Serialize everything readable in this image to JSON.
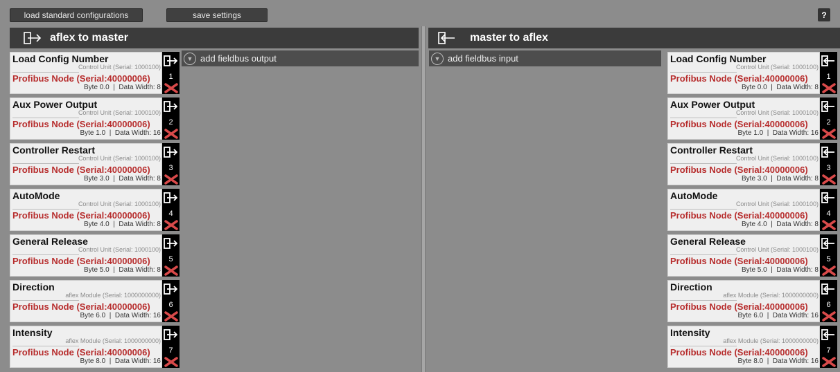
{
  "toolbar": {
    "load_label": "load standard configurations",
    "save_label": "save settings",
    "help_label": "?"
  },
  "left_panel": {
    "title": "aflex to master",
    "add_label": "add fieldbus output",
    "items": [
      {
        "name": "Load Config Number",
        "unit": "Control Unit (Serial: 1000100)",
        "node": "Profibus Node (Serial:40000006)",
        "byte": "Byte 0.0  |  Data Width: 8",
        "num": "1"
      },
      {
        "name": "Aux Power Output",
        "unit": "Control Unit (Serial: 1000100)",
        "node": "Profibus Node (Serial:40000006)",
        "byte": "Byte 1.0  |  Data Width: 16",
        "num": "2"
      },
      {
        "name": "Controller Restart",
        "unit": "Control Unit (Serial: 1000100)",
        "node": "Profibus Node (Serial:40000006)",
        "byte": "Byte 3.0  |  Data Width: 8",
        "num": "3"
      },
      {
        "name": "AutoMode",
        "unit": "Control Unit (Serial: 1000100)",
        "node": "Profibus Node (Serial:40000006)",
        "byte": "Byte 4.0  |  Data Width: 8",
        "num": "4"
      },
      {
        "name": "General Release",
        "unit": "Control Unit (Serial: 1000100)",
        "node": "Profibus Node (Serial:40000006)",
        "byte": "Byte 5.0  |  Data Width: 8",
        "num": "5"
      },
      {
        "name": "Direction",
        "unit": "aflex Module (Serial: 1000000000)",
        "node": "Profibus Node (Serial:40000006)",
        "byte": "Byte 6.0  |  Data Width: 16",
        "num": "6"
      },
      {
        "name": "Intensity",
        "unit": "aflex Module (Serial: 1000000000)",
        "node": "Profibus Node (Serial:40000006)",
        "byte": "Byte 8.0  |  Data Width: 16",
        "num": "7"
      }
    ]
  },
  "right_panel": {
    "title": "master to aflex",
    "add_label": "add fieldbus input",
    "items": [
      {
        "name": "Load Config Number",
        "unit": "Control Unit (Serial: 1000100)",
        "node": "Profibus Node (Serial:40000006)",
        "byte": "Byte 0.0  |  Data Width: 8",
        "num": "1"
      },
      {
        "name": "Aux Power Output",
        "unit": "Control Unit (Serial: 1000100)",
        "node": "Profibus Node (Serial:40000006)",
        "byte": "Byte 1.0  |  Data Width: 16",
        "num": "2"
      },
      {
        "name": "Controller Restart",
        "unit": "Control Unit (Serial: 1000100)",
        "node": "Profibus Node (Serial:40000006)",
        "byte": "Byte 3.0  |  Data Width: 8",
        "num": "3"
      },
      {
        "name": "AutoMode",
        "unit": "Control Unit (Serial: 1000100)",
        "node": "Profibus Node (Serial:40000006)",
        "byte": "Byte 4.0  |  Data Width: 8",
        "num": "4"
      },
      {
        "name": "General Release",
        "unit": "Control Unit (Serial: 1000100)",
        "node": "Profibus Node (Serial:40000006)",
        "byte": "Byte 5.0  |  Data Width: 8",
        "num": "5"
      },
      {
        "name": "Direction",
        "unit": "aflex Module (Serial: 1000000000)",
        "node": "Profibus Node (Serial:40000006)",
        "byte": "Byte 6.0  |  Data Width: 16",
        "num": "6"
      },
      {
        "name": "Intensity",
        "unit": "aflex Module (Serial: 1000000000)",
        "node": "Profibus Node (Serial:40000006)",
        "byte": "Byte 8.0  |  Data Width: 16",
        "num": "7"
      }
    ]
  },
  "icons": {
    "out": "export-arrow-icon",
    "in": "import-arrow-icon",
    "delete": "delete-x-icon",
    "expand": "chevron-down-circle-icon"
  },
  "colors": {
    "node_text": "#b72d2d",
    "delete": "#d94a4a",
    "header_bg": "#3b3b3b"
  }
}
